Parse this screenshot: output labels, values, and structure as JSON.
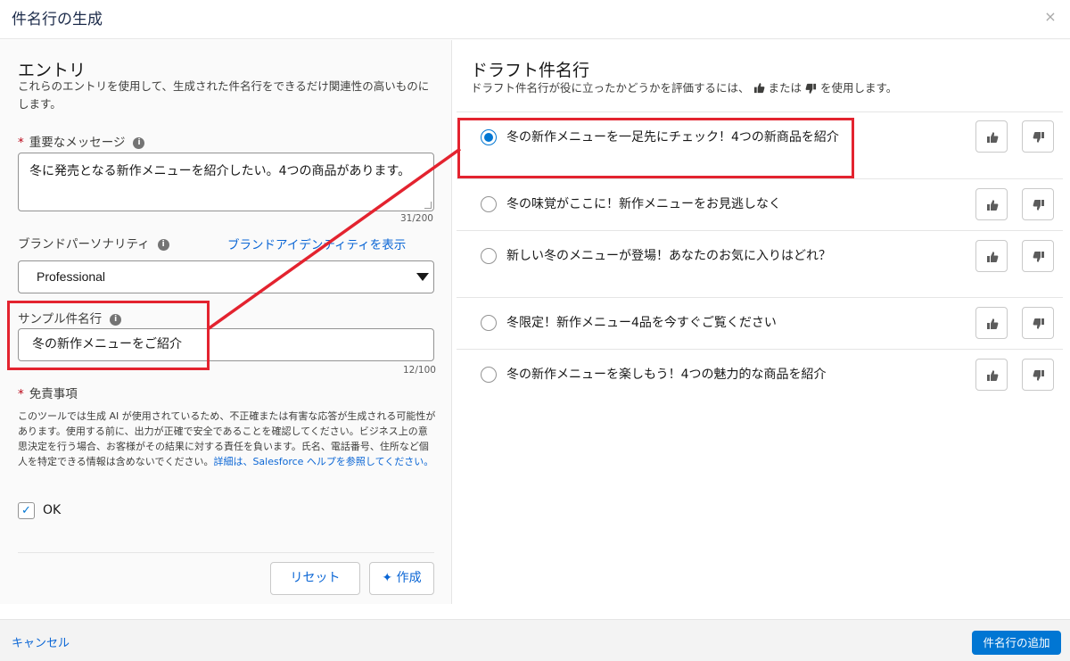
{
  "modal": {
    "title": "件名行の生成",
    "close_icon": "×"
  },
  "entries": {
    "heading": "エントリ",
    "description": "これらのエントリを使用して、生成された件名行をできるだけ関連性の高いものにします。",
    "message": {
      "required_mark": "*",
      "label": "重要なメッセージ",
      "info_icon": "i",
      "value": "冬に発売となる新作メニューを紹介したい。4つの商品があります。",
      "count": "31/200"
    },
    "brand": {
      "label": "ブランドパーソナリティ",
      "info_icon": "i",
      "link": "ブランドアイデンティティを表示",
      "selected": "Professional"
    },
    "sample": {
      "label": "サンプル件名行",
      "info_icon": "i",
      "value": "冬の新作メニューをご紹介",
      "count": "12/100"
    },
    "disclaimer": {
      "required_mark": "*",
      "label": "免責事項",
      "text": "このツールでは生成 AI が使用されているため、不正確または有害な応答が生成される可能性があります。使用する前に、出力が正確で安全であることを確認してください。ビジネス上の意思決定を行う場合、お客様がその結果に対する責任を負います。氏名、電話番号、住所など個人を特定できる情報は含めないでください。",
      "link": "詳細は、Salesforce ヘルプを参照してください。"
    },
    "ok_checkbox": {
      "checked": true,
      "mark": "✓",
      "label": "OK"
    },
    "buttons": {
      "reset": "リセット",
      "create_icon": "✦",
      "create": "作成"
    }
  },
  "drafts": {
    "heading": "ドラフト件名行",
    "description_pre": "ドラフト件名行が役に立ったかどうかを評価するには、",
    "description_mid": "または",
    "description_post": "を使用します。",
    "items": [
      {
        "text": "冬の新作メニューを一足先にチェック！4つの新商品を紹介",
        "selected": true
      },
      {
        "text": "冬の味覚がここに！新作メニューをお見逃しなく",
        "selected": false
      },
      {
        "text": "新しい冬のメニューが登場！あなたのお気に入りはどれ？",
        "selected": false
      },
      {
        "text": "冬限定！新作メニュー4品を今すぐご覧ください",
        "selected": false
      },
      {
        "text": "冬の新作メニューを楽しもう！4つの魅力的な商品を紹介",
        "selected": false
      }
    ]
  },
  "footer": {
    "cancel": "キャンセル",
    "add": "件名行の追加"
  },
  "colors": {
    "brand": "#0176d3",
    "link": "#0b66d5",
    "callout": "#e3232f",
    "required": "#ba0517"
  }
}
